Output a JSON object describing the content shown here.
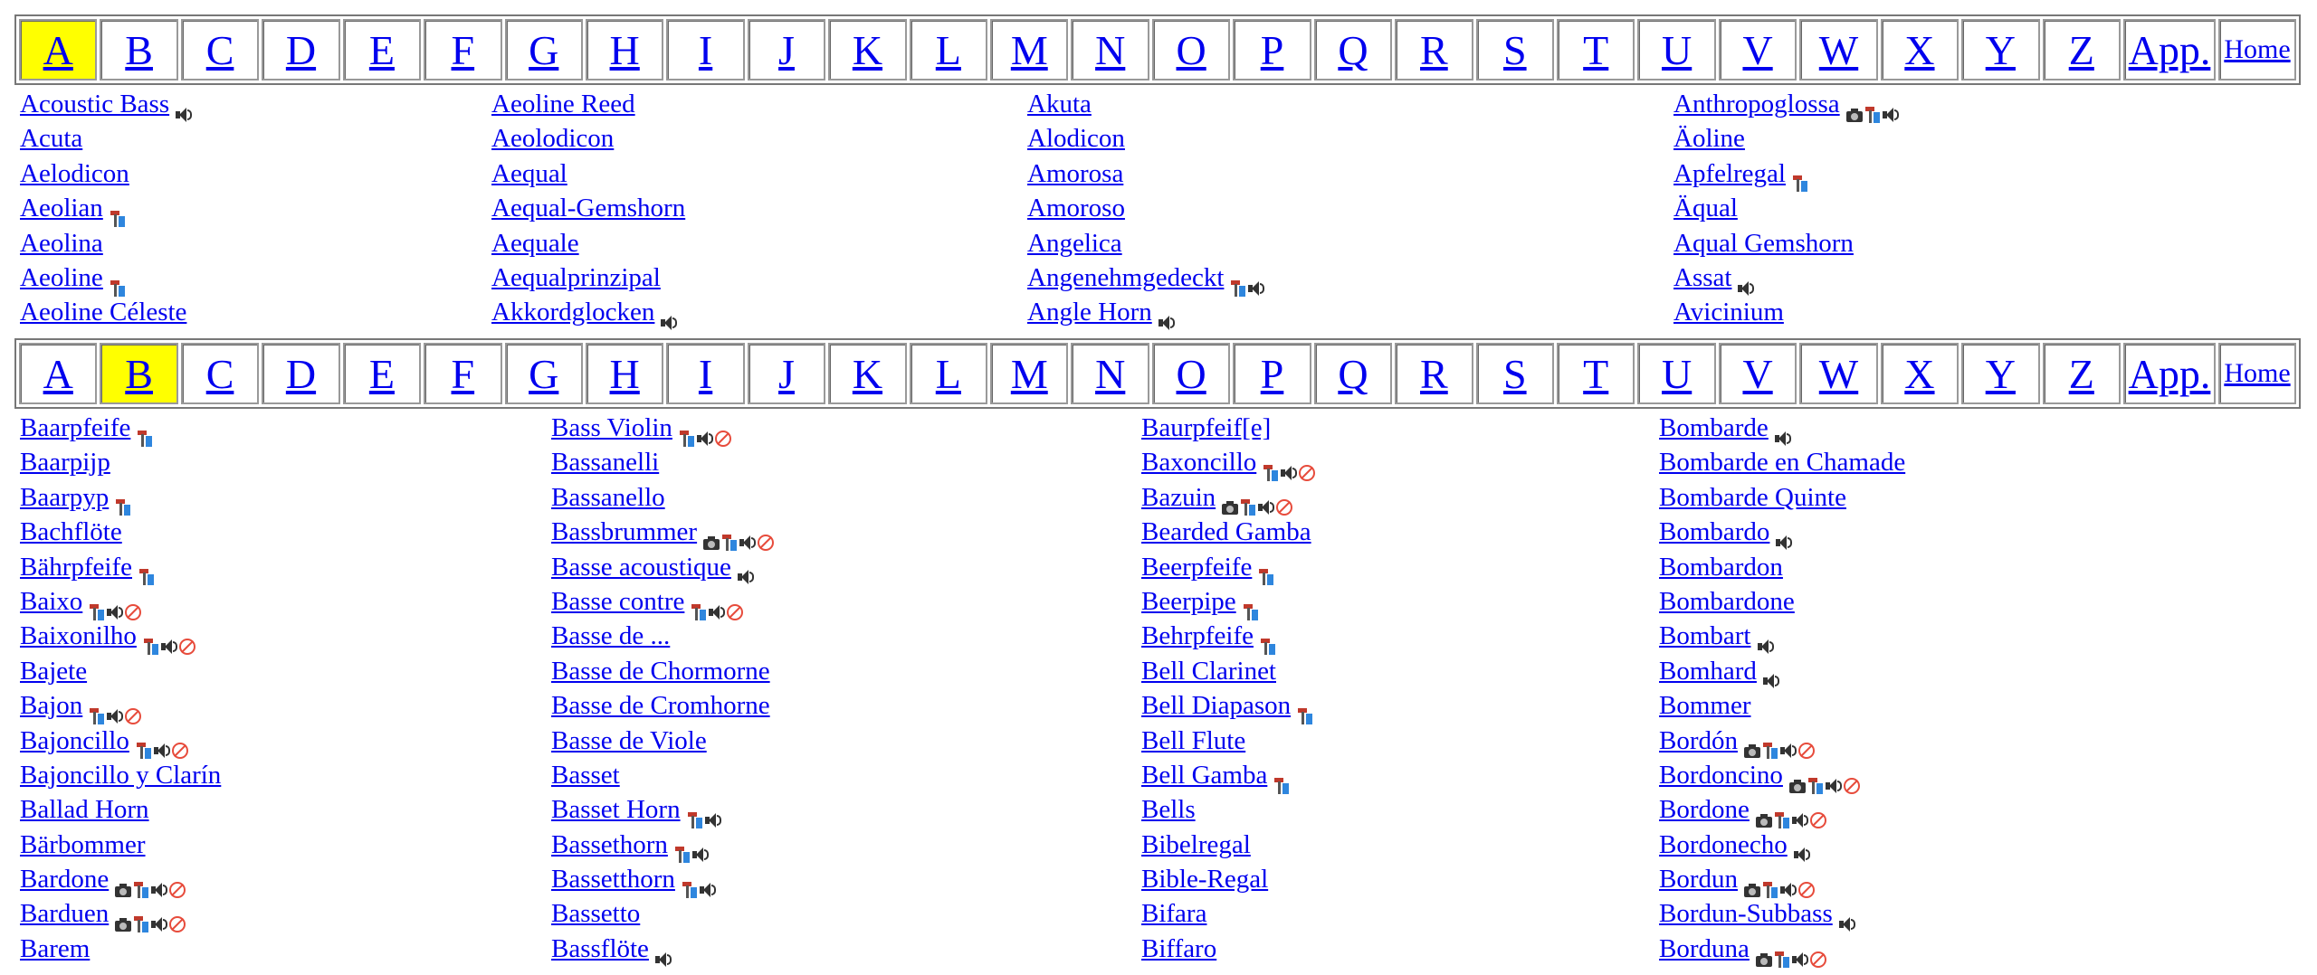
{
  "nav": {
    "letters": [
      "A",
      "B",
      "C",
      "D",
      "E",
      "F",
      "G",
      "H",
      "I",
      "J",
      "K",
      "L",
      "M",
      "N",
      "O",
      "P",
      "Q",
      "R",
      "S",
      "T",
      "U",
      "V",
      "W",
      "X",
      "Y",
      "Z"
    ],
    "app_label": "App.",
    "home_label": "Home",
    "highlight_color": "#ffff00"
  },
  "sections": [
    {
      "selected_letter": "A",
      "columns": [
        [
          {
            "label": "Acoustic Bass",
            "icons": [
              "speaker"
            ]
          },
          {
            "label": "Acuta",
            "icons": []
          },
          {
            "label": "Aelodicon",
            "icons": []
          },
          {
            "label": "Aeolian",
            "icons": [
              "tools"
            ]
          },
          {
            "label": "Aeolina",
            "icons": []
          },
          {
            "label": "Aeoline",
            "icons": [
              "tools"
            ]
          },
          {
            "label": "Aeoline Céleste",
            "icons": []
          }
        ],
        [
          {
            "label": "Aeoline Reed",
            "icons": []
          },
          {
            "label": "Aeolodicon",
            "icons": []
          },
          {
            "label": "Aequal",
            "icons": []
          },
          {
            "label": "Aequal-Gemshorn",
            "icons": []
          },
          {
            "label": "Aequale",
            "icons": []
          },
          {
            "label": "Aequalprinzipal",
            "icons": []
          },
          {
            "label": "Akkordglocken",
            "icons": [
              "speaker"
            ]
          }
        ],
        [
          {
            "label": "Akuta",
            "icons": []
          },
          {
            "label": "Alodicon",
            "icons": []
          },
          {
            "label": "Amorosa",
            "icons": []
          },
          {
            "label": "Amoroso",
            "icons": []
          },
          {
            "label": "Angelica",
            "icons": []
          },
          {
            "label": "Angenehmgedeckt",
            "icons": [
              "tools",
              "speaker"
            ]
          },
          {
            "label": "Angle Horn",
            "icons": [
              "speaker"
            ]
          }
        ],
        [
          {
            "label": "Anthropoglossa",
            "icons": [
              "camera",
              "tools",
              "speaker"
            ]
          },
          {
            "label": "Äoline",
            "icons": []
          },
          {
            "label": "Apfelregal",
            "icons": [
              "tools"
            ]
          },
          {
            "label": "Äqual",
            "icons": []
          },
          {
            "label": "Aqual Gemshorn",
            "icons": []
          },
          {
            "label": "Assat",
            "icons": [
              "speaker"
            ]
          },
          {
            "label": "Avicinium",
            "icons": []
          }
        ]
      ]
    },
    {
      "selected_letter": "B",
      "columns": [
        [
          {
            "label": "Baarpfeife",
            "icons": [
              "tools"
            ]
          },
          {
            "label": "Baarpijp",
            "icons": []
          },
          {
            "label": "Baarpyp",
            "icons": [
              "tools"
            ]
          },
          {
            "label": "Bachflöte",
            "icons": []
          },
          {
            "label": "Bährpfeife",
            "icons": [
              "tools"
            ]
          },
          {
            "label": "Baixo",
            "icons": [
              "tools",
              "speaker",
              "no"
            ]
          },
          {
            "label": "Baixonilho",
            "icons": [
              "tools",
              "speaker",
              "no"
            ]
          },
          {
            "label": "Bajete",
            "icons": []
          },
          {
            "label": "Bajon",
            "icons": [
              "tools",
              "speaker",
              "no"
            ]
          },
          {
            "label": "Bajoncillo",
            "icons": [
              "tools",
              "speaker",
              "no"
            ]
          },
          {
            "label": "Bajoncillo y Clarín",
            "icons": []
          },
          {
            "label": "Ballad Horn",
            "icons": []
          },
          {
            "label": "Bärbommer",
            "icons": []
          },
          {
            "label": "Bardone",
            "icons": [
              "camera",
              "tools",
              "speaker",
              "no"
            ]
          },
          {
            "label": "Barduen",
            "icons": [
              "camera",
              "tools",
              "speaker",
              "no"
            ]
          },
          {
            "label": "Barem",
            "icons": []
          }
        ],
        [
          {
            "label": "Bass Violin",
            "icons": [
              "tools",
              "speaker",
              "no"
            ]
          },
          {
            "label": "Bassanelli",
            "icons": []
          },
          {
            "label": "Bassanello",
            "icons": []
          },
          {
            "label": "Bassbrummer",
            "icons": [
              "camera",
              "tools",
              "speaker",
              "no"
            ]
          },
          {
            "label": "Basse acoustique",
            "icons": [
              "speaker"
            ]
          },
          {
            "label": "Basse contre",
            "icons": [
              "tools",
              "speaker",
              "no"
            ]
          },
          {
            "label": "Basse de ...",
            "icons": []
          },
          {
            "label": "Basse de Chormorne",
            "icons": []
          },
          {
            "label": "Basse de Cromhorne",
            "icons": []
          },
          {
            "label": "Basse de Viole",
            "icons": []
          },
          {
            "label": "Basset",
            "icons": []
          },
          {
            "label": "Basset Horn",
            "icons": [
              "tools",
              "speaker"
            ]
          },
          {
            "label": "Bassethorn",
            "icons": [
              "tools",
              "speaker"
            ]
          },
          {
            "label": "Bassetthorn",
            "icons": [
              "tools",
              "speaker"
            ]
          },
          {
            "label": "Bassetto",
            "icons": []
          },
          {
            "label": "Bassflöte",
            "icons": [
              "speaker"
            ]
          }
        ],
        [
          {
            "label": "Baurpfeif[e]",
            "icons": []
          },
          {
            "label": "Baxoncillo",
            "icons": [
              "tools",
              "speaker",
              "no"
            ]
          },
          {
            "label": "Bazuin",
            "icons": [
              "camera",
              "tools",
              "speaker",
              "no"
            ]
          },
          {
            "label": "Bearded Gamba",
            "icons": []
          },
          {
            "label": "Beerpfeife",
            "icons": [
              "tools"
            ]
          },
          {
            "label": "Beerpipe",
            "icons": [
              "tools"
            ]
          },
          {
            "label": "Behrpfeife",
            "icons": [
              "tools"
            ]
          },
          {
            "label": "Bell Clarinet",
            "icons": []
          },
          {
            "label": "Bell Diapason",
            "icons": [
              "tools"
            ]
          },
          {
            "label": "Bell Flute",
            "icons": []
          },
          {
            "label": "Bell Gamba",
            "icons": [
              "tools"
            ]
          },
          {
            "label": "Bells",
            "icons": []
          },
          {
            "label": "Bibelregal",
            "icons": []
          },
          {
            "label": "Bible-Regal",
            "icons": []
          },
          {
            "label": "Bifara",
            "icons": []
          },
          {
            "label": "Biffaro",
            "icons": []
          }
        ],
        [
          {
            "label": "Bombarde",
            "icons": [
              "speaker"
            ]
          },
          {
            "label": "Bombarde en Chamade",
            "icons": []
          },
          {
            "label": "Bombarde Quinte",
            "icons": []
          },
          {
            "label": "Bombardo",
            "icons": [
              "speaker"
            ]
          },
          {
            "label": "Bombardon",
            "icons": []
          },
          {
            "label": "Bombardone",
            "icons": []
          },
          {
            "label": "Bombart",
            "icons": [
              "speaker"
            ]
          },
          {
            "label": "Bomhard",
            "icons": [
              "speaker"
            ]
          },
          {
            "label": "Bommer",
            "icons": []
          },
          {
            "label": "Bordón",
            "icons": [
              "camera",
              "tools",
              "speaker",
              "no"
            ]
          },
          {
            "label": "Bordoncino",
            "icons": [
              "camera",
              "tools",
              "speaker",
              "no"
            ]
          },
          {
            "label": "Bordone",
            "icons": [
              "camera",
              "tools",
              "speaker",
              "no"
            ]
          },
          {
            "label": "Bordonecho",
            "icons": [
              "speaker"
            ]
          },
          {
            "label": "Bordun",
            "icons": [
              "camera",
              "tools",
              "speaker",
              "no"
            ]
          },
          {
            "label": "Bordun-Subbass",
            "icons": [
              "speaker"
            ]
          },
          {
            "label": "Borduna",
            "icons": [
              "camera",
              "tools",
              "speaker",
              "no"
            ]
          }
        ]
      ]
    }
  ]
}
